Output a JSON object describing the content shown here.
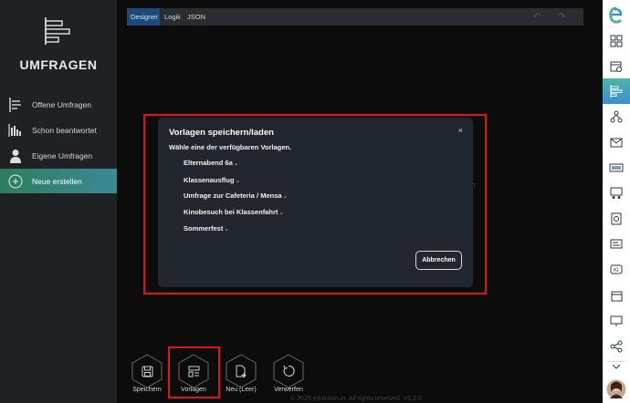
{
  "app": {
    "title": "UMFRAGEN",
    "logo_icon": "survey-logo-icon"
  },
  "sidebar": {
    "items": [
      {
        "label": "Offene Umfragen",
        "icon": "list-icon"
      },
      {
        "label": "Schon beantwortet",
        "icon": "bar-chart-icon"
      },
      {
        "label": "Eigene Umfragen",
        "icon": "person-icon"
      },
      {
        "label": "Neue erstellen",
        "icon": "plus-circle-icon",
        "active": true
      }
    ]
  },
  "tabs": [
    {
      "label": "Designer",
      "active": true
    },
    {
      "label": "Logik"
    },
    {
      "label": "JSON"
    }
  ],
  "background": {
    "partial_text": "nten",
    "footer": "© 2025 edulution.io. All rights reserved. V1.2.0"
  },
  "modal": {
    "title": "Vorlagen speichern/laden",
    "close_symbol": "×",
    "subtitle": "Wähle eine der verfügbaren Vorlagen.",
    "templates": [
      "Elternabend 6a",
      "Klassenausflug",
      "Umfrage zur Cafeteria / Mensa",
      "Kinobesuch bei Klassenfahrt",
      "Sommerfest"
    ],
    "cancel_label": "Abbrechen"
  },
  "toolbar": {
    "save_label": "Speichern",
    "templates_label": "Vorlagen",
    "new_label": "Neu (Leer)",
    "discard_label": "Verwerfen"
  },
  "rail": {
    "icons": [
      "edulution-logo-icon",
      "dashboard-icon",
      "file-share-icon",
      "survey-icon",
      "network-icon",
      "mail-icon",
      "device-icon",
      "classroom-icon",
      "settings-icon",
      "whiteboard-icon",
      "conference-icon",
      "chat-icon",
      "calendar-icon",
      "presentation-icon",
      "share-icon",
      "user-avatar"
    ],
    "colors": {
      "active_from": "#4fb3a8",
      "active_to": "#3a8fcf",
      "icon": "#2b3a4a"
    }
  },
  "colors": {
    "highlight": "#e0121b",
    "active_nav_from": "#2f7d5f",
    "active_nav_to": "#3a8a98",
    "tab_active": "#1e4a79",
    "modal_bg": "#22262e"
  }
}
